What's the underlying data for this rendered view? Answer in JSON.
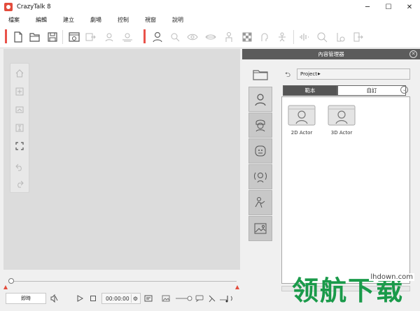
{
  "window": {
    "title": "CrazyTalk 8",
    "minimize_glyph": "─",
    "maximize_glyph": "☐",
    "close_glyph": "✕"
  },
  "menu": {
    "items": [
      "檔案",
      "編輯",
      "建立",
      "劇場",
      "控制",
      "視窗",
      "說明"
    ]
  },
  "toolbar": {
    "icons": [
      "new-file-icon",
      "open-folder-icon",
      "save-icon",
      "media-icon",
      "import-icon",
      "face-fitting-icon",
      "head-adjust-icon",
      "actor-icon",
      "face-orient-icon",
      "eye-icon",
      "mouth-icon",
      "body-icon",
      "background-icon",
      "head-icon",
      "bone-icon",
      "audio-icon",
      "face-puppet-icon",
      "body-puppet-icon"
    ],
    "accent_color": "#e9524a"
  },
  "viewport_tools": [
    "home-icon",
    "move-icon",
    "zoom-region-icon",
    "zoom-icon",
    "fit-icon",
    "undo-icon",
    "redo-icon"
  ],
  "playback": {
    "mode_label": "即時",
    "time": "00:00:00",
    "marker_color": "#e34c3c"
  },
  "content_manager": {
    "title": "內容管理器",
    "path": "Project",
    "tabs": [
      {
        "label": "範本",
        "selected": true
      },
      {
        "label": "自訂",
        "selected": false
      }
    ],
    "categories": [
      "folder-icon",
      "actor-icon",
      "head-icon",
      "face-icon",
      "audio-icon",
      "motion-icon",
      "image-icon"
    ],
    "items": [
      {
        "label": "2D Actor"
      },
      {
        "label": "3D Actor"
      }
    ]
  },
  "watermark": {
    "text": "领航下载",
    "url": "lhdown.com",
    "color": "#1a9a4a"
  }
}
